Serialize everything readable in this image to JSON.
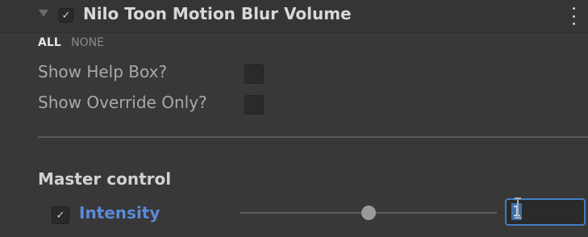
{
  "component": {
    "title": "Nilo Toon Motion Blur Volume",
    "enabled": true,
    "expanded": true
  },
  "toolbar": {
    "all_label": "ALL",
    "none_label": "NONE"
  },
  "options": [
    {
      "label": "Show Help Box?",
      "checked": false
    },
    {
      "label": "Show Override Only?",
      "checked": false
    }
  ],
  "section": {
    "title": "Master control"
  },
  "intensity": {
    "label": "Intensity",
    "override_checked": true,
    "value": "1",
    "slider_fraction": 0.5
  },
  "icons": {
    "foldout": "foldout-triangle-icon",
    "check": "checkmark-icon",
    "menu": "kebab-menu-icon",
    "cursor": "text-cursor-icon"
  },
  "colors": {
    "background": "#383838",
    "label_override": "#5c8ad6",
    "focus_border": "#3f7fc0"
  }
}
